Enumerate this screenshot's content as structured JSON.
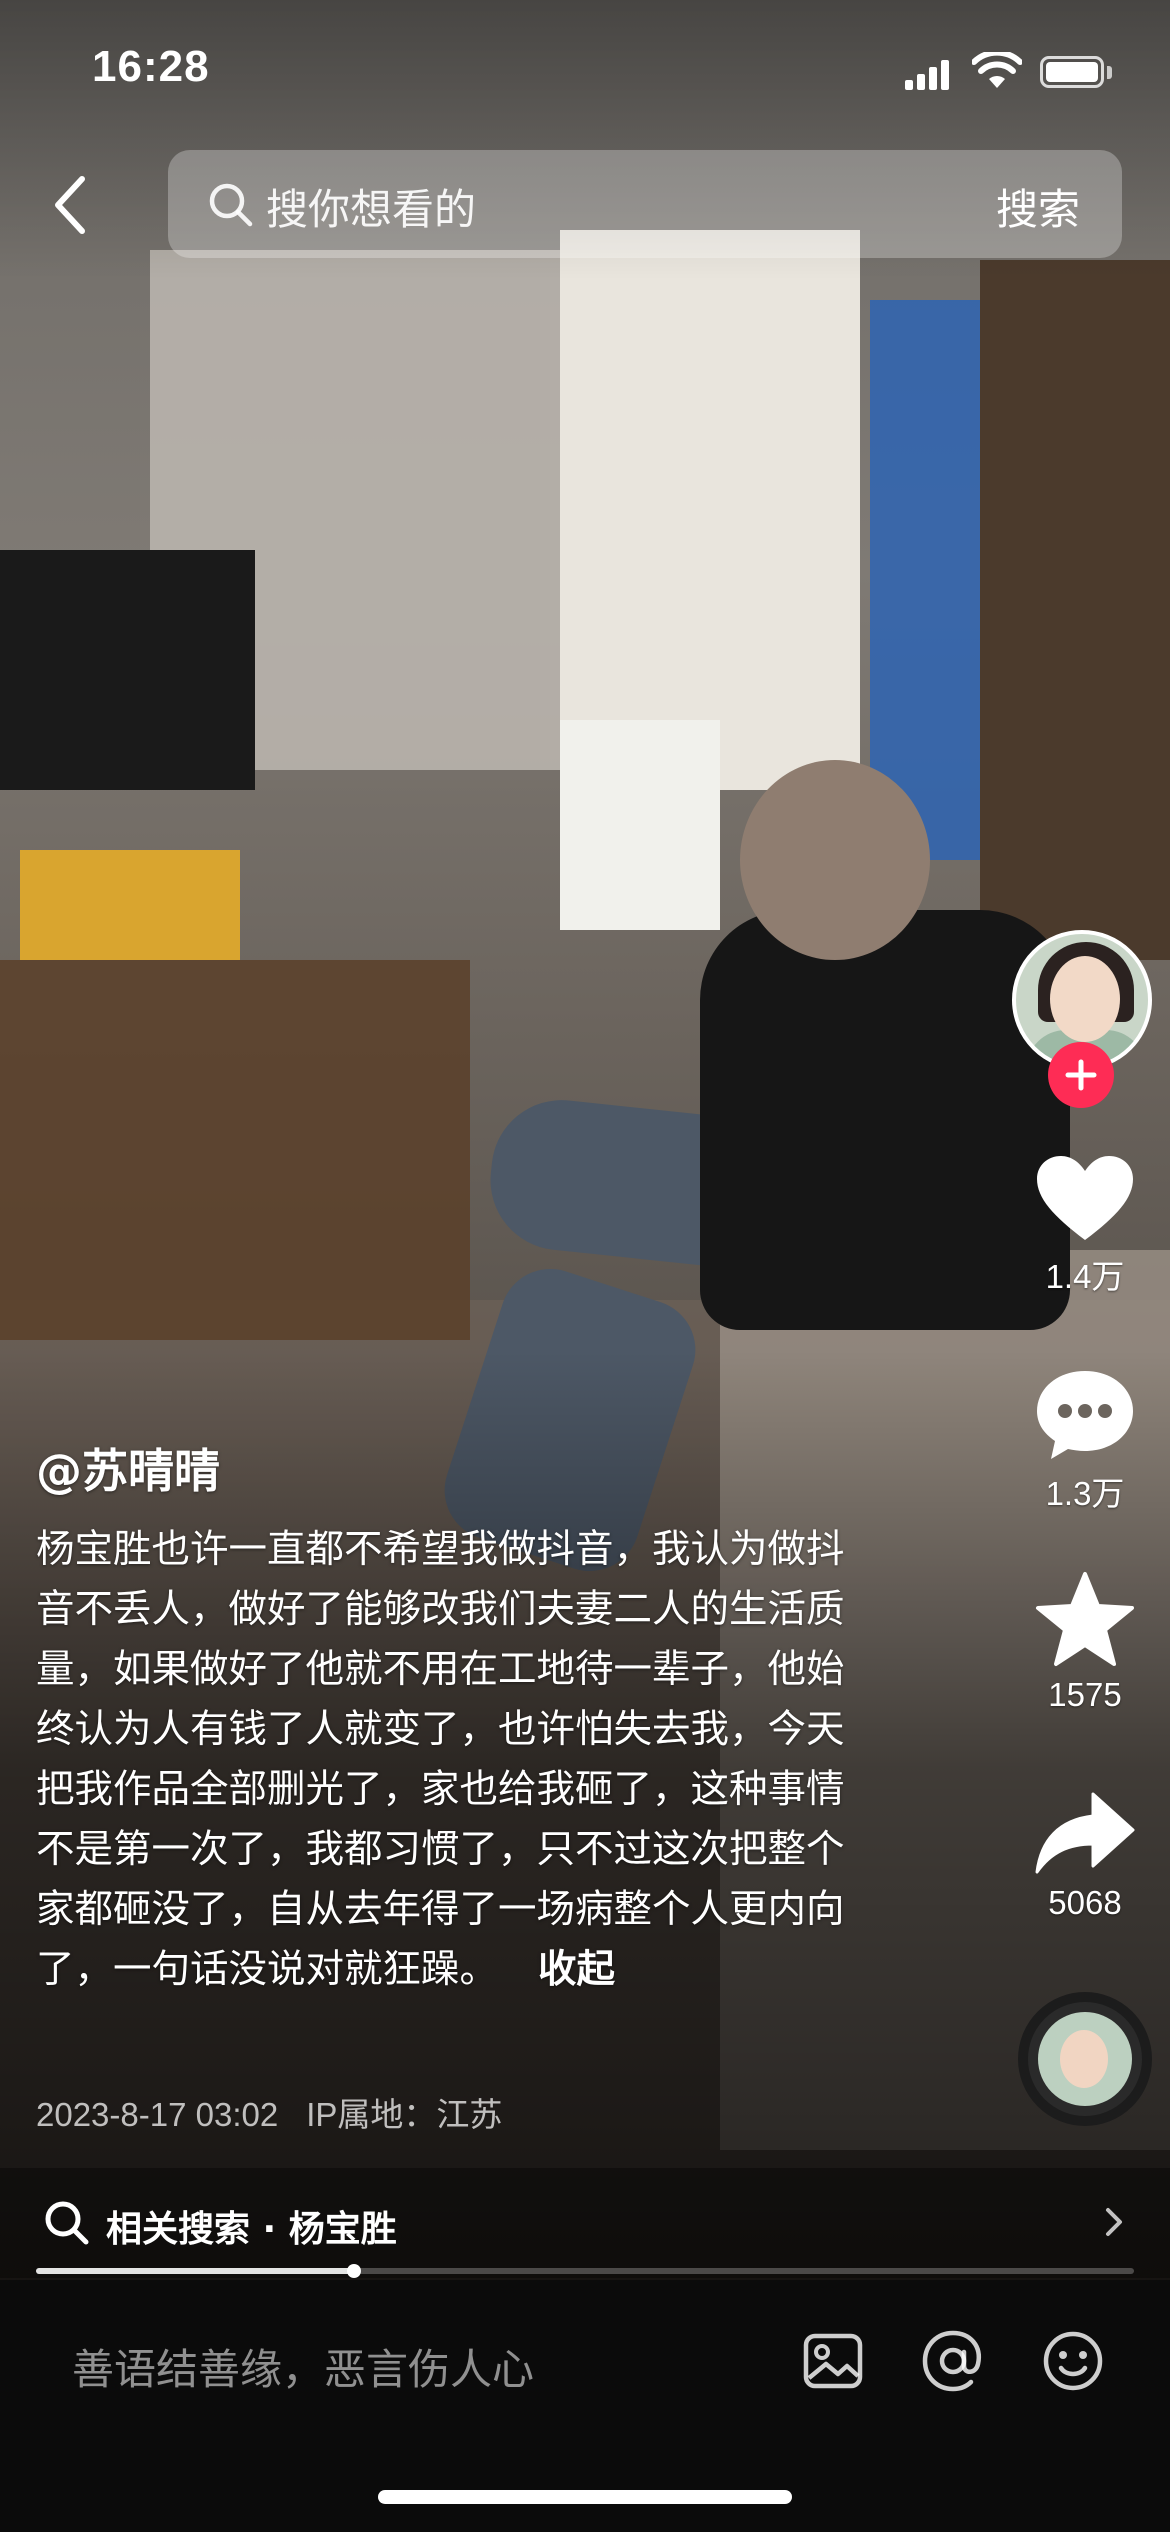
{
  "status_bar": {
    "time": "16:28"
  },
  "search": {
    "placeholder": "搜你想看的",
    "button_label": "搜索"
  },
  "author": {
    "handle": "@苏晴晴"
  },
  "description": {
    "text": "杨宝胜也许一直都不希望我做抖音，我认为做抖音不丢人，做好了能够改我们夫妻二人的生活质量，如果做好了他就不用在工地待一辈子，他始终认为人有钱了人就变了，也许怕失去我，今天把我作品全部删光了，家也给我砸了，这种事情不是第一次了，我都习惯了，只不过这次把整个家都砸没了，自从去年得了一场病整个人更内向了，一句话没说对就狂躁。",
    "collapse_label": "收起"
  },
  "meta": {
    "datetime": "2023-8-17 03:02",
    "ip_location": "IP属地：江苏"
  },
  "actions": {
    "likes": "1.4万",
    "comments": "1.3万",
    "favorites": "1575",
    "shares": "5068"
  },
  "related_search": {
    "label": "相关搜索 · 杨宝胜"
  },
  "playback": {
    "progress": 0.29
  },
  "comment_bar": {
    "placeholder": "善语结善缘，恶言伤人心"
  },
  "colors": {
    "accent": "#fe2c55",
    "background": "#0b0b0b"
  },
  "icons": [
    "back-icon",
    "search-icon",
    "plus-icon",
    "heart-icon",
    "comment-icon",
    "star-icon",
    "share-icon",
    "music-disc-icon",
    "chevron-right-icon",
    "image-icon",
    "at-icon",
    "emoji-icon"
  ]
}
